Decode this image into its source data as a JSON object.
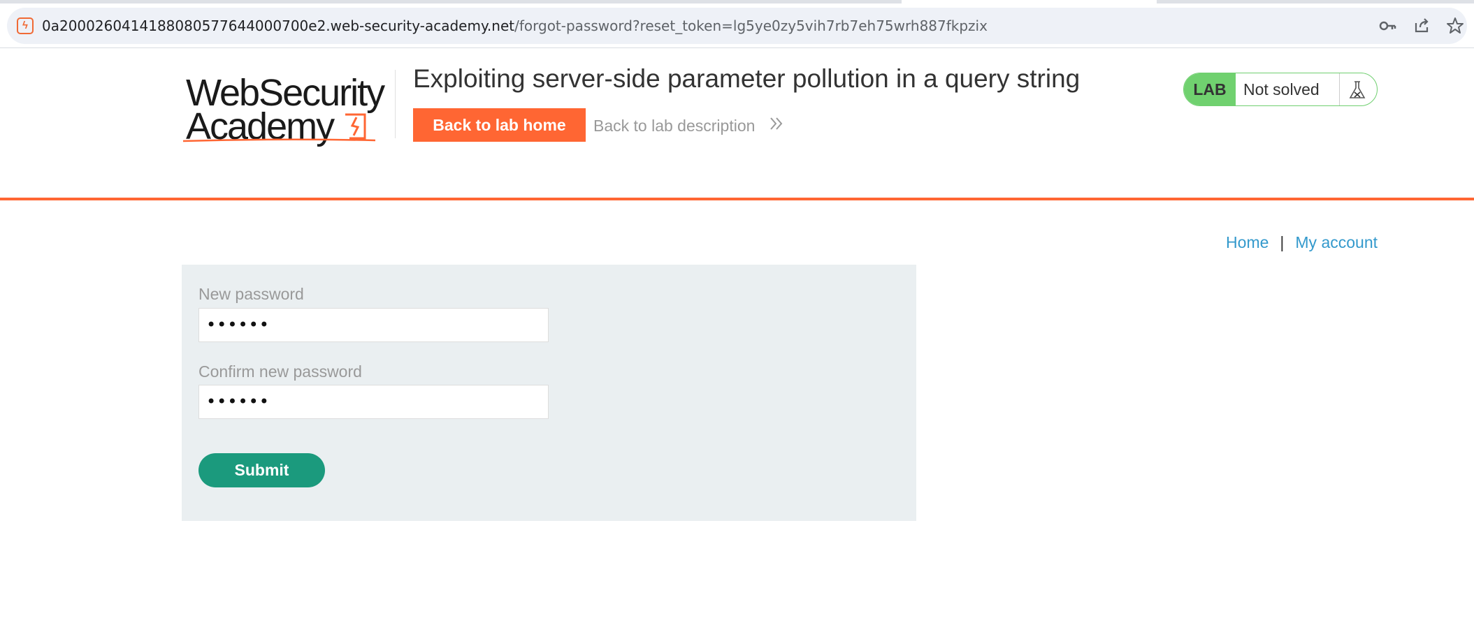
{
  "browser": {
    "url_host": "0a2000260414188080577644000700e2.web-security-academy.net",
    "url_path": "/forgot-password?reset_token=lg5ye0zy5vih7rb7eh75wrh887fkpzix",
    "icons": [
      "key-icon",
      "share-icon",
      "star-icon"
    ]
  },
  "header": {
    "logo_line1": "WebSecurity",
    "logo_line2": "Academy",
    "lab_title": "Exploiting server-side parameter pollution in a query string",
    "back_home_label": "Back to lab home",
    "back_description_label": "Back to lab description",
    "badge_tag": "LAB",
    "badge_status": "Not solved",
    "accent_color": "#ff6633",
    "badge_color": "#70d16f"
  },
  "nav": {
    "home": "Home",
    "separator": "|",
    "my_account": "My account"
  },
  "form": {
    "new_password_label": "New password",
    "new_password_value": "••••••",
    "confirm_password_label": "Confirm new password",
    "confirm_password_value": "••••••",
    "submit_label": "Submit",
    "submit_color": "#1b9a7d"
  }
}
